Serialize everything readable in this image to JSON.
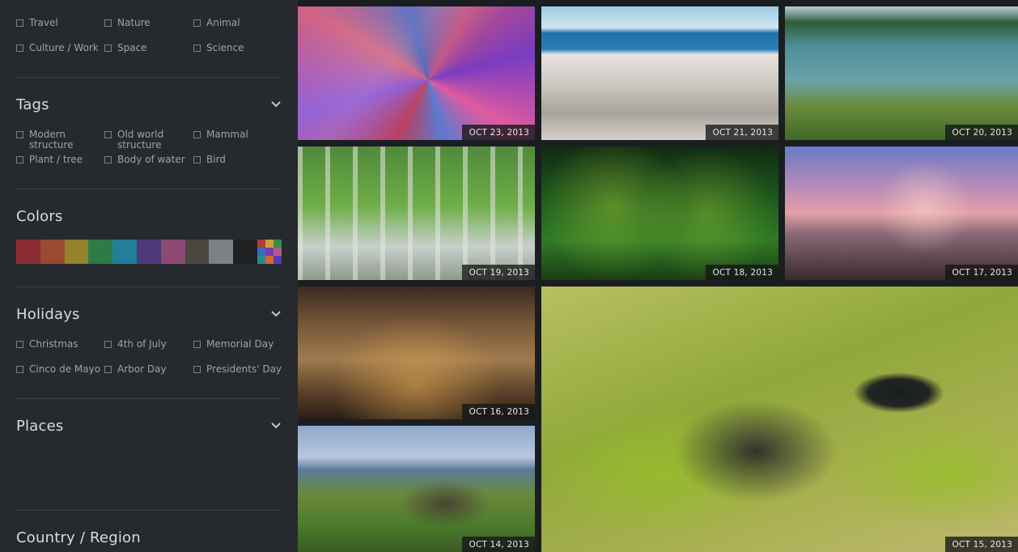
{
  "categories": {
    "items": [
      "Travel",
      "Nature",
      "Animal",
      "Culture / Work",
      "Space",
      "Science"
    ]
  },
  "tags": {
    "title": "Tags",
    "items": [
      "Modern structure",
      "Old world structure",
      "Mammal",
      "Plant / tree",
      "Body of water",
      "Bird"
    ]
  },
  "colors": {
    "title": "Colors",
    "swatches": [
      "#8b2c33",
      "#9a4a31",
      "#93832a",
      "#2f7a45",
      "#227f9a",
      "#4e3a79",
      "#8c4a72",
      "#4c4640",
      "#7e8184",
      "#1f2123"
    ],
    "multi": [
      "#b33a3a",
      "#c9a23a",
      "#3a8a4a",
      "#3a6fb3",
      "#7a3ab3",
      "#b35a8a",
      "#2a8a8a",
      "#d06a2a",
      "#5a3ab3"
    ]
  },
  "holidays": {
    "title": "Holidays",
    "items": [
      "Christmas",
      "4th of July",
      "Memorial Day",
      "Cinco de Mayo",
      "Arbor Day",
      "Presidents' Day"
    ]
  },
  "places": {
    "title": "Places"
  },
  "country": {
    "title": "Country / Region"
  },
  "gallery": {
    "dates": [
      "OCT 23, 2013",
      "OCT 21, 2013",
      "OCT 20, 2013",
      "OCT 19, 2013",
      "OCT 18, 2013",
      "OCT 17, 2013",
      "OCT 16, 2013",
      "OCT 15, 2013",
      "OCT 14, 2013"
    ]
  }
}
